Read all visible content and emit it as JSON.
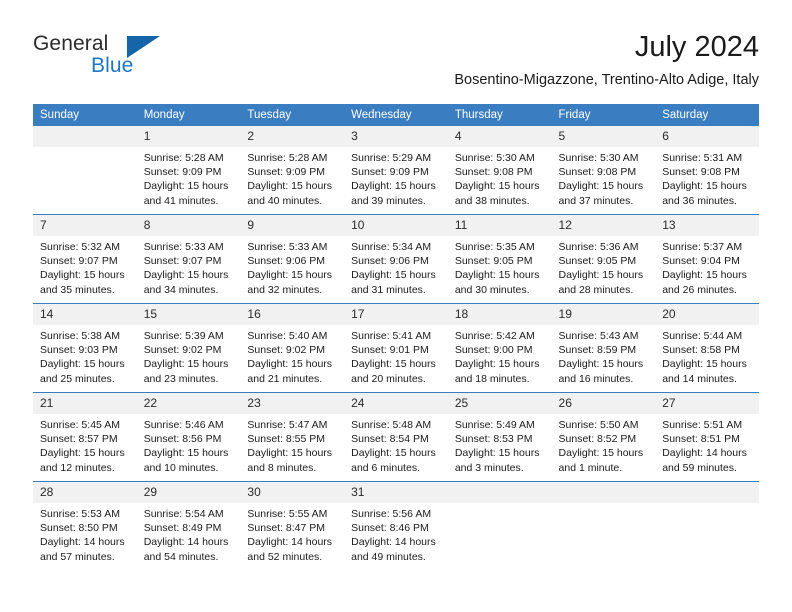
{
  "brand": {
    "name_primary": "General",
    "name_secondary": "Blue",
    "flag_color": "#1565a8",
    "accent_color": "#1f77c4"
  },
  "header": {
    "title": "July 2024",
    "location": "Bosentino-Migazzone, Trentino-Alto Adige, Italy",
    "header_bg": "#3a7dc0",
    "daynum_bg": "#f1f1f1"
  },
  "weekday_headers": [
    "Sunday",
    "Monday",
    "Tuesday",
    "Wednesday",
    "Thursday",
    "Friday",
    "Saturday"
  ],
  "weeks": [
    [
      {
        "day": "",
        "empty": true,
        "sunrise": "",
        "sunset": "",
        "daylight_line1": "",
        "daylight_line2": ""
      },
      {
        "day": "1",
        "sunrise": "Sunrise: 5:28 AM",
        "sunset": "Sunset: 9:09 PM",
        "daylight_line1": "Daylight: 15 hours",
        "daylight_line2": "and 41 minutes."
      },
      {
        "day": "2",
        "sunrise": "Sunrise: 5:28 AM",
        "sunset": "Sunset: 9:09 PM",
        "daylight_line1": "Daylight: 15 hours",
        "daylight_line2": "and 40 minutes."
      },
      {
        "day": "3",
        "sunrise": "Sunrise: 5:29 AM",
        "sunset": "Sunset: 9:09 PM",
        "daylight_line1": "Daylight: 15 hours",
        "daylight_line2": "and 39 minutes."
      },
      {
        "day": "4",
        "sunrise": "Sunrise: 5:30 AM",
        "sunset": "Sunset: 9:08 PM",
        "daylight_line1": "Daylight: 15 hours",
        "daylight_line2": "and 38 minutes."
      },
      {
        "day": "5",
        "sunrise": "Sunrise: 5:30 AM",
        "sunset": "Sunset: 9:08 PM",
        "daylight_line1": "Daylight: 15 hours",
        "daylight_line2": "and 37 minutes."
      },
      {
        "day": "6",
        "sunrise": "Sunrise: 5:31 AM",
        "sunset": "Sunset: 9:08 PM",
        "daylight_line1": "Daylight: 15 hours",
        "daylight_line2": "and 36 minutes."
      }
    ],
    [
      {
        "day": "7",
        "sunrise": "Sunrise: 5:32 AM",
        "sunset": "Sunset: 9:07 PM",
        "daylight_line1": "Daylight: 15 hours",
        "daylight_line2": "and 35 minutes."
      },
      {
        "day": "8",
        "sunrise": "Sunrise: 5:33 AM",
        "sunset": "Sunset: 9:07 PM",
        "daylight_line1": "Daylight: 15 hours",
        "daylight_line2": "and 34 minutes."
      },
      {
        "day": "9",
        "sunrise": "Sunrise: 5:33 AM",
        "sunset": "Sunset: 9:06 PM",
        "daylight_line1": "Daylight: 15 hours",
        "daylight_line2": "and 32 minutes."
      },
      {
        "day": "10",
        "sunrise": "Sunrise: 5:34 AM",
        "sunset": "Sunset: 9:06 PM",
        "daylight_line1": "Daylight: 15 hours",
        "daylight_line2": "and 31 minutes."
      },
      {
        "day": "11",
        "sunrise": "Sunrise: 5:35 AM",
        "sunset": "Sunset: 9:05 PM",
        "daylight_line1": "Daylight: 15 hours",
        "daylight_line2": "and 30 minutes."
      },
      {
        "day": "12",
        "sunrise": "Sunrise: 5:36 AM",
        "sunset": "Sunset: 9:05 PM",
        "daylight_line1": "Daylight: 15 hours",
        "daylight_line2": "and 28 minutes."
      },
      {
        "day": "13",
        "sunrise": "Sunrise: 5:37 AM",
        "sunset": "Sunset: 9:04 PM",
        "daylight_line1": "Daylight: 15 hours",
        "daylight_line2": "and 26 minutes."
      }
    ],
    [
      {
        "day": "14",
        "sunrise": "Sunrise: 5:38 AM",
        "sunset": "Sunset: 9:03 PM",
        "daylight_line1": "Daylight: 15 hours",
        "daylight_line2": "and 25 minutes."
      },
      {
        "day": "15",
        "sunrise": "Sunrise: 5:39 AM",
        "sunset": "Sunset: 9:02 PM",
        "daylight_line1": "Daylight: 15 hours",
        "daylight_line2": "and 23 minutes."
      },
      {
        "day": "16",
        "sunrise": "Sunrise: 5:40 AM",
        "sunset": "Sunset: 9:02 PM",
        "daylight_line1": "Daylight: 15 hours",
        "daylight_line2": "and 21 minutes."
      },
      {
        "day": "17",
        "sunrise": "Sunrise: 5:41 AM",
        "sunset": "Sunset: 9:01 PM",
        "daylight_line1": "Daylight: 15 hours",
        "daylight_line2": "and 20 minutes."
      },
      {
        "day": "18",
        "sunrise": "Sunrise: 5:42 AM",
        "sunset": "Sunset: 9:00 PM",
        "daylight_line1": "Daylight: 15 hours",
        "daylight_line2": "and 18 minutes."
      },
      {
        "day": "19",
        "sunrise": "Sunrise: 5:43 AM",
        "sunset": "Sunset: 8:59 PM",
        "daylight_line1": "Daylight: 15 hours",
        "daylight_line2": "and 16 minutes."
      },
      {
        "day": "20",
        "sunrise": "Sunrise: 5:44 AM",
        "sunset": "Sunset: 8:58 PM",
        "daylight_line1": "Daylight: 15 hours",
        "daylight_line2": "and 14 minutes."
      }
    ],
    [
      {
        "day": "21",
        "sunrise": "Sunrise: 5:45 AM",
        "sunset": "Sunset: 8:57 PM",
        "daylight_line1": "Daylight: 15 hours",
        "daylight_line2": "and 12 minutes."
      },
      {
        "day": "22",
        "sunrise": "Sunrise: 5:46 AM",
        "sunset": "Sunset: 8:56 PM",
        "daylight_line1": "Daylight: 15 hours",
        "daylight_line2": "and 10 minutes."
      },
      {
        "day": "23",
        "sunrise": "Sunrise: 5:47 AM",
        "sunset": "Sunset: 8:55 PM",
        "daylight_line1": "Daylight: 15 hours",
        "daylight_line2": "and 8 minutes."
      },
      {
        "day": "24",
        "sunrise": "Sunrise: 5:48 AM",
        "sunset": "Sunset: 8:54 PM",
        "daylight_line1": "Daylight: 15 hours",
        "daylight_line2": "and 6 minutes."
      },
      {
        "day": "25",
        "sunrise": "Sunrise: 5:49 AM",
        "sunset": "Sunset: 8:53 PM",
        "daylight_line1": "Daylight: 15 hours",
        "daylight_line2": "and 3 minutes."
      },
      {
        "day": "26",
        "sunrise": "Sunrise: 5:50 AM",
        "sunset": "Sunset: 8:52 PM",
        "daylight_line1": "Daylight: 15 hours",
        "daylight_line2": "and 1 minute."
      },
      {
        "day": "27",
        "sunrise": "Sunrise: 5:51 AM",
        "sunset": "Sunset: 8:51 PM",
        "daylight_line1": "Daylight: 14 hours",
        "daylight_line2": "and 59 minutes."
      }
    ],
    [
      {
        "day": "28",
        "sunrise": "Sunrise: 5:53 AM",
        "sunset": "Sunset: 8:50 PM",
        "daylight_line1": "Daylight: 14 hours",
        "daylight_line2": "and 57 minutes."
      },
      {
        "day": "29",
        "sunrise": "Sunrise: 5:54 AM",
        "sunset": "Sunset: 8:49 PM",
        "daylight_line1": "Daylight: 14 hours",
        "daylight_line2": "and 54 minutes."
      },
      {
        "day": "30",
        "sunrise": "Sunrise: 5:55 AM",
        "sunset": "Sunset: 8:47 PM",
        "daylight_line1": "Daylight: 14 hours",
        "daylight_line2": "and 52 minutes."
      },
      {
        "day": "31",
        "sunrise": "Sunrise: 5:56 AM",
        "sunset": "Sunset: 8:46 PM",
        "daylight_line1": "Daylight: 14 hours",
        "daylight_line2": "and 49 minutes."
      },
      {
        "day": "",
        "empty": true,
        "sunrise": "",
        "sunset": "",
        "daylight_line1": "",
        "daylight_line2": ""
      },
      {
        "day": "",
        "empty": true,
        "sunrise": "",
        "sunset": "",
        "daylight_line1": "",
        "daylight_line2": ""
      },
      {
        "day": "",
        "empty": true,
        "sunrise": "",
        "sunset": "",
        "daylight_line1": "",
        "daylight_line2": ""
      }
    ]
  ]
}
